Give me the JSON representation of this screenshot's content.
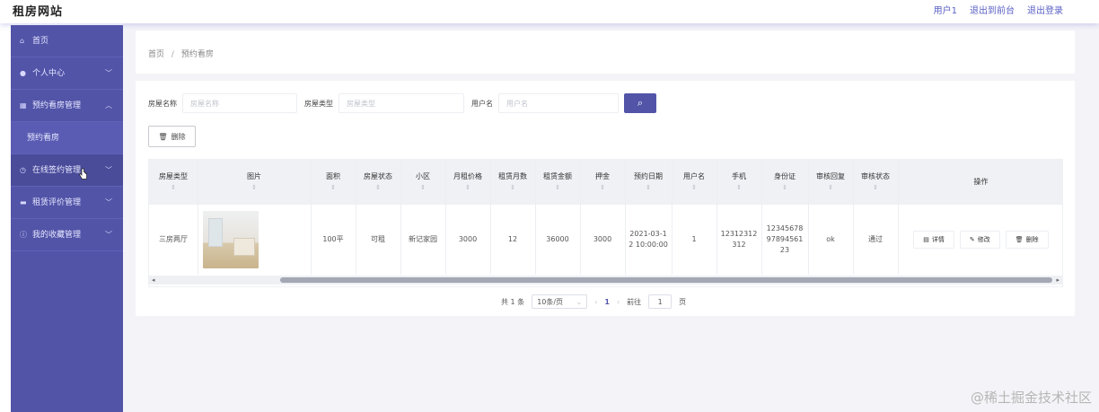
{
  "app": {
    "title": "租房网站"
  },
  "header": {
    "links": [
      "用户1",
      "退出到前台",
      "退出登录"
    ]
  },
  "sidebar": {
    "items": [
      {
        "label": "首页",
        "icon": "home-icon",
        "chevron": ""
      },
      {
        "label": "个人中心",
        "icon": "user-icon",
        "chevron": "﹀"
      },
      {
        "label": "预约看房管理",
        "icon": "calendar-icon",
        "chevron": "︿"
      },
      {
        "label": "预约看房",
        "icon": "",
        "chevron": ""
      },
      {
        "label": "在线签约管理",
        "icon": "clock-icon",
        "chevron": "﹀"
      },
      {
        "label": "租赁评价管理",
        "icon": "list-icon",
        "chevron": "﹀"
      },
      {
        "label": "我的收藏管理",
        "icon": "info-icon",
        "chevron": "﹀"
      }
    ]
  },
  "breadcrumb": {
    "home": "首页",
    "separator": "/",
    "current": "预约看房"
  },
  "search": {
    "fields": [
      {
        "label": "房屋名称",
        "placeholder": "房屋名称"
      },
      {
        "label": "房屋类型",
        "placeholder": "房屋类型"
      },
      {
        "label": "用户名",
        "placeholder": "用户名"
      }
    ],
    "button_icon": "search-icon"
  },
  "toolbar": {
    "delete_label": "删除",
    "delete_icon": "🗑"
  },
  "table": {
    "headers": [
      "房屋类型",
      "图片",
      "面积",
      "房屋状态",
      "小区",
      "月租价格",
      "租赁月数",
      "租赁金额",
      "押金",
      "预约日期",
      "用户名",
      "手机",
      "身份证",
      "审核回复",
      "审核状态",
      "操作"
    ],
    "sort_mark": "⇕",
    "rows": [
      {
        "type": "三房两厅",
        "area": "100平",
        "status": "可租",
        "community": "新记家园",
        "monthly_price": "3000",
        "months": "12",
        "amount": "36000",
        "deposit": "3000",
        "date": "2021-03-12 10:00:00",
        "username": "1",
        "phone": "12312312312",
        "id_card": "123456789789456123",
        "reply": "ok",
        "audit_status": "通过"
      }
    ],
    "actions": [
      "详情",
      "修改",
      "删除"
    ]
  },
  "pagination": {
    "total_text": "共 1 条",
    "page_size": "10条/页",
    "current_page": "1",
    "goto_label": "前往",
    "goto_value": "1",
    "page_suffix": "页"
  },
  "watermark": "@稀土掘金技术社区",
  "colors": {
    "accent": "#5254a8",
    "sidebar": "#5254a8",
    "background": "#f4f4f8"
  }
}
